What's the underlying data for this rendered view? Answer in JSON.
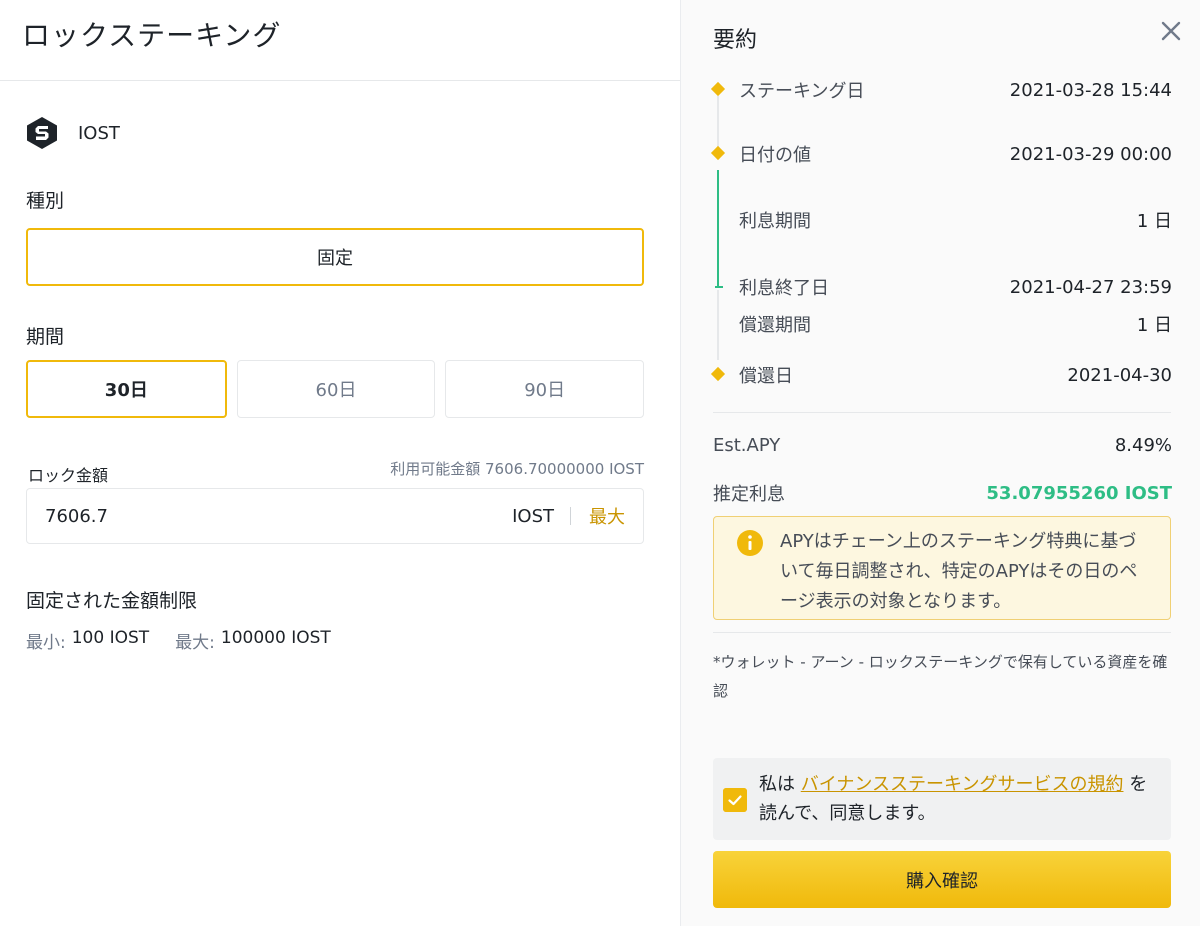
{
  "header": {
    "title": "ロックステーキング"
  },
  "coin": {
    "icon": "iost-logo-icon",
    "name": "IOST"
  },
  "type": {
    "label": "種別",
    "value": "固定"
  },
  "period": {
    "label": "期間",
    "options": [
      {
        "label": "30日",
        "selected": true
      },
      {
        "label": "60日",
        "selected": false
      },
      {
        "label": "90日",
        "selected": false
      }
    ]
  },
  "amount": {
    "label": "ロック金額",
    "available_label": "利用可能金額",
    "available_value": "7606.70000000 IOST",
    "value": "7606.7",
    "unit": "IOST",
    "max_label": "最大"
  },
  "limits": {
    "title": "固定された金額制限",
    "min_label": "最小:",
    "min_value": "100 IOST",
    "max_label": "最大:",
    "max_value": "100000 IOST"
  },
  "summary": {
    "title": "要約",
    "close_icon": "close-icon",
    "timeline": [
      {
        "label": "ステーキング日",
        "value": "2021-03-28 15:44"
      },
      {
        "label": "日付の値",
        "value": "2021-03-29 00:00"
      },
      {
        "label": "利息期間",
        "value": "1 日"
      },
      {
        "label": "利息終了日",
        "value": "2021-04-27 23:59"
      },
      {
        "label": "償還期間",
        "value": "1 日"
      },
      {
        "label": "償還日",
        "value": "2021-04-30"
      }
    ],
    "apy_label": "Est.APY",
    "apy_value": "8.49%",
    "interest_label": "推定利息",
    "interest_value": "53.07955260 IOST",
    "notice": "APYはチェーン上のステーキング特典に基づいて毎日調整され、特定のAPYはその日のページ表示の対象となります。",
    "footnote": "*ウォレット - アーン - ロックステーキングで保有している資産を確認",
    "agree_prefix": "私は",
    "agree_link": "バイナンスステーキングサービスの規約",
    "agree_suffix": "を読んで、同意します。",
    "agree_checked": true,
    "confirm_label": "購入確認"
  },
  "colors": {
    "accent": "#f0b90b",
    "link": "#c99400",
    "positive": "#2ebd85",
    "notice_bg": "#fdf7e0"
  }
}
